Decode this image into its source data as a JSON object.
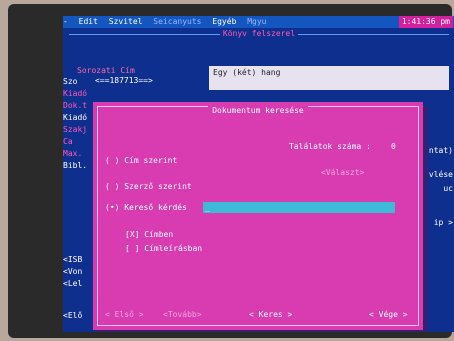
{
  "menubar": {
    "items": [
      "-",
      "Edit",
      "Szvitel",
      "Seicanyuts",
      "Egyéb",
      "Mgyu"
    ],
    "clock": "1:41:36 pm"
  },
  "form": {
    "title": "Könyv felszerel",
    "sorozati_cim_label": "Sorozati Cím",
    "sorozat_number": "<==187713==>",
    "title_value": "Egy (két) hang"
  },
  "side_left": [
    "Szo",
    "Kiadó",
    "Dok.t",
    "Kiadó",
    "Szakj",
    "Ca",
    "Max.",
    "Bibl."
  ],
  "right_labels": [
    "ntat)",
    "vlése",
    "uc",
    "ip >"
  ],
  "bottom_left": [
    "<ISB",
    "<Von",
    "<Lel",
    "<Elő"
  ],
  "dialog": {
    "title": "Dokumentum keresése",
    "results_label": "Találatok száma :",
    "results_value": "0",
    "select_button": "<Választ>",
    "options": [
      {
        "marker": "( )",
        "label": "Cím szerint"
      },
      {
        "marker": "( )",
        "label": "Szerző szerint"
      },
      {
        "marker": "(•)",
        "label": "Kereső kérdés"
      }
    ],
    "query_value": "_",
    "checks": [
      {
        "marker": "[X]",
        "label": "Címben"
      },
      {
        "marker": "[ ]",
        "label": "Címleírásban"
      }
    ],
    "buttons": {
      "first": "< Első >",
      "next": "<Tovább>",
      "search": "< Keres >",
      "end": "< Vége >"
    }
  }
}
